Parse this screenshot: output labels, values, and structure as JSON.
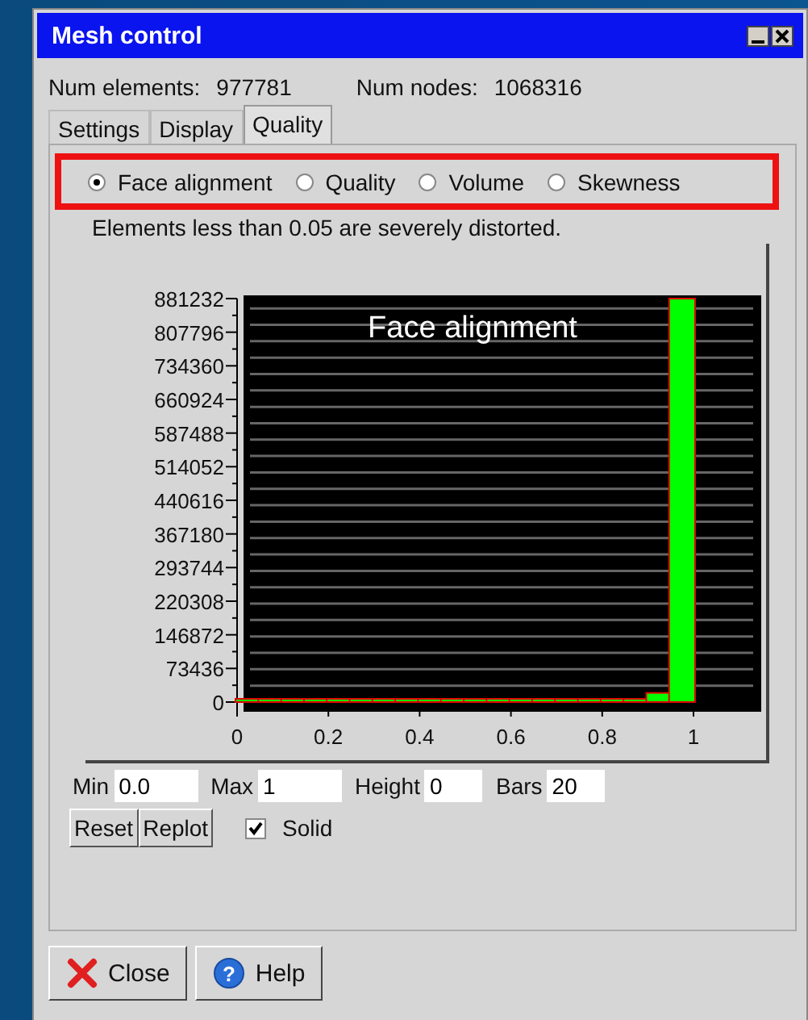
{
  "window": {
    "title": "Mesh control"
  },
  "stats": [
    {
      "label": "Num elements:",
      "value": "977781"
    },
    {
      "label": "Num nodes:",
      "value": "1068316"
    }
  ],
  "tabs": [
    {
      "label": "Settings",
      "selected": false
    },
    {
      "label": "Display",
      "selected": false
    },
    {
      "label": "Quality",
      "selected": true
    }
  ],
  "metrics": [
    {
      "label": "Face alignment",
      "selected": true
    },
    {
      "label": "Quality",
      "selected": false
    },
    {
      "label": "Volume",
      "selected": false
    },
    {
      "label": "Skewness",
      "selected": false
    }
  ],
  "note": "Elements less than 0.05 are severely distorted.",
  "chart": {
    "chart_data": {
      "type": "bar",
      "title": "Face alignment",
      "x": [
        0.025,
        0.075,
        0.125,
        0.175,
        0.225,
        0.275,
        0.325,
        0.375,
        0.425,
        0.475,
        0.525,
        0.575,
        0.625,
        0.675,
        0.725,
        0.775,
        0.825,
        0.875,
        0.925,
        0.975
      ],
      "series": [
        {
          "color": "#00ff00",
          "values": [
            0,
            0,
            0,
            0,
            0,
            0,
            0,
            0,
            0,
            0,
            0,
            0,
            0,
            0,
            0,
            0,
            0,
            0,
            20000,
            881232
          ]
        }
      ],
      "xlim": [
        0,
        1.14
      ],
      "ylim": [
        0,
        881232
      ],
      "grid": true,
      "xticks": [
        0,
        0.2,
        0.4,
        0.6,
        0.8,
        1
      ],
      "yticks": [
        0,
        73436,
        146872,
        220308,
        293744,
        367180,
        440616,
        514052,
        587488,
        660924,
        734360,
        807796,
        881232
      ]
    }
  },
  "fields": [
    {
      "label": "Min",
      "value": "0.0"
    },
    {
      "label": "Max",
      "value": "1"
    },
    {
      "label": "Height",
      "value": "0"
    },
    {
      "label": "Bars",
      "value": "20"
    }
  ],
  "buttons": [
    "Reset",
    "Replot"
  ],
  "solid": {
    "label": "Solid",
    "checked": true
  },
  "footer_buttons": [
    {
      "label": "Close",
      "kind": "close"
    },
    {
      "label": "Help",
      "kind": "help",
      "icon": "?"
    }
  ]
}
